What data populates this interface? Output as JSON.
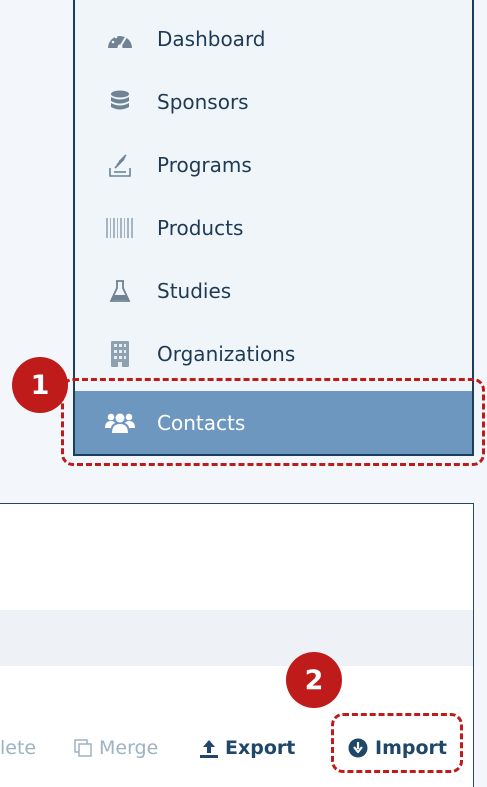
{
  "menu": {
    "items": [
      {
        "label": "Dashboard",
        "icon": "dashboard-gauge-icon"
      },
      {
        "label": "Sponsors",
        "icon": "database-icon"
      },
      {
        "label": "Programs",
        "icon": "inbox-stack-icon"
      },
      {
        "label": "Products",
        "icon": "barcode-icon"
      },
      {
        "label": "Studies",
        "icon": "flask-icon"
      },
      {
        "label": "Organizations",
        "icon": "building-icon"
      },
      {
        "label": "Contacts",
        "icon": "users-icon",
        "active": true
      }
    ]
  },
  "toolbar": {
    "delete_partial": "lete",
    "merge": "Merge",
    "export": "Export",
    "import": "Import"
  },
  "annotations": {
    "step1": "1",
    "step2": "2"
  },
  "colors": {
    "active_item_bg": "#6e97bf",
    "annotation_red": "#c01b1b",
    "menu_border": "#1d3f5e"
  }
}
